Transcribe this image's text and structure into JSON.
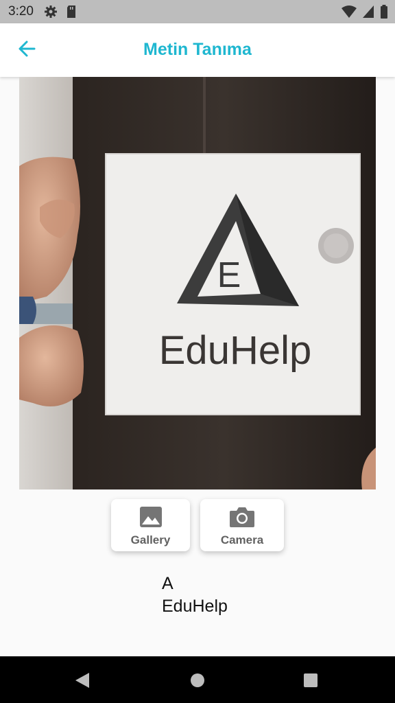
{
  "status_bar": {
    "time": "3:20",
    "left_icons": [
      "gear-icon",
      "sd-card-icon"
    ],
    "right_icons": [
      "wifi-icon",
      "signal-icon",
      "battery-icon"
    ]
  },
  "app_bar": {
    "title": "Metin Tanıma",
    "back_icon": "arrow-back-icon",
    "accent_color": "#1fb7d0"
  },
  "image_preview": {
    "logo_letter": "E",
    "logo_text": "EduHelp"
  },
  "buttons": [
    {
      "label": "Gallery",
      "icon": "image-icon"
    },
    {
      "label": "Camera",
      "icon": "camera-icon"
    }
  ],
  "result": {
    "text": "A\nEduHelp"
  },
  "nav_bar": {
    "icons": [
      "back-triangle-icon",
      "home-circle-icon",
      "recents-square-icon"
    ]
  }
}
